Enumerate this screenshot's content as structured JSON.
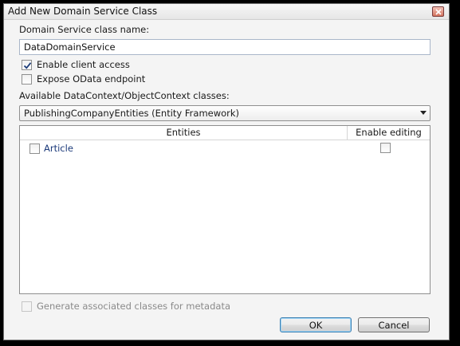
{
  "window": {
    "title": "Add New Domain Service Class"
  },
  "service_name": {
    "label": "Domain Service class name:",
    "value": "DataDomainService"
  },
  "options": {
    "enable_client_access": {
      "label": "Enable client access",
      "checked": true
    },
    "expose_odata": {
      "label": "Expose OData endpoint",
      "checked": false
    }
  },
  "context": {
    "label": "Available DataContext/ObjectContext classes:",
    "selected": "PublishingCompanyEntities (Entity Framework)"
  },
  "entities": {
    "columns": [
      "Entities",
      "Enable editing"
    ],
    "rows": [
      {
        "name": "Article",
        "selected": false,
        "enable_editing": false
      }
    ]
  },
  "metadata": {
    "label": "Generate associated classes for metadata",
    "enabled": false
  },
  "buttons": {
    "ok": "OK",
    "cancel": "Cancel"
  },
  "icons": {
    "close": "close-icon",
    "check": "checkmark-icon",
    "dropdown": "chevron-down-icon"
  }
}
